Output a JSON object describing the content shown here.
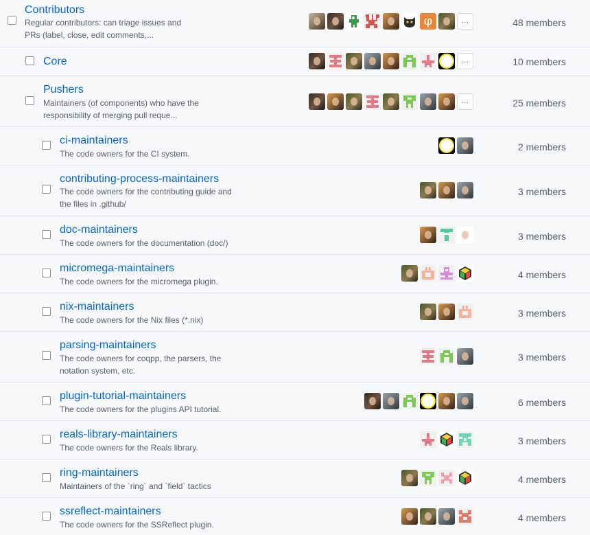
{
  "teams": [
    {
      "name": "Contributors",
      "description": "Regular contributors: can triage issues and PRs (label, close, edit comments,...",
      "members_label": "48 members",
      "more": "…"
    },
    {
      "name": "Core",
      "description": "",
      "members_label": "10 members",
      "more": "…"
    },
    {
      "name": "Pushers",
      "description": "Maintainers (of components) who have the responsibility of merging pull reque...",
      "members_label": "25 members",
      "more": "…"
    },
    {
      "name": "ci-maintainers",
      "description": "The code owners for the CI system.",
      "members_label": "2 members"
    },
    {
      "name": "contributing-process-maintainers",
      "description": "The code owners for the contributing guide and the files in .github/",
      "members_label": "3 members"
    },
    {
      "name": "doc-maintainers",
      "description": "The code owners for the documentation (doc/)",
      "members_label": "3 members"
    },
    {
      "name": "micromega-maintainers",
      "description": "The code owners for the micromega plugin.",
      "members_label": "4 members"
    },
    {
      "name": "nix-maintainers",
      "description": "The code owners for the Nix files (*.nix)",
      "members_label": "3 members"
    },
    {
      "name": "parsing-maintainers",
      "description": "The code owners for coqpp, the parsers, the notation system, etc.",
      "members_label": "3 members"
    },
    {
      "name": "plugin-tutorial-maintainers",
      "description": "The code owners for the plugins API tutorial.",
      "members_label": "6 members"
    },
    {
      "name": "reals-library-maintainers",
      "description": "The code owners for the Reals library.",
      "members_label": "3 members"
    },
    {
      "name": "ring-maintainers",
      "description": "Maintainers of the `ring` and `field` tactics",
      "members_label": "4 members"
    },
    {
      "name": "ssreflect-maintainers",
      "description": "The code owners for the SSReflect plugin.",
      "members_label": "4 members"
    }
  ],
  "phi_glyph": "φ",
  "colors": {
    "link": "#0366d6",
    "muted": "#586069",
    "border": "#e1e4e8",
    "background": "#f6f8fa"
  }
}
